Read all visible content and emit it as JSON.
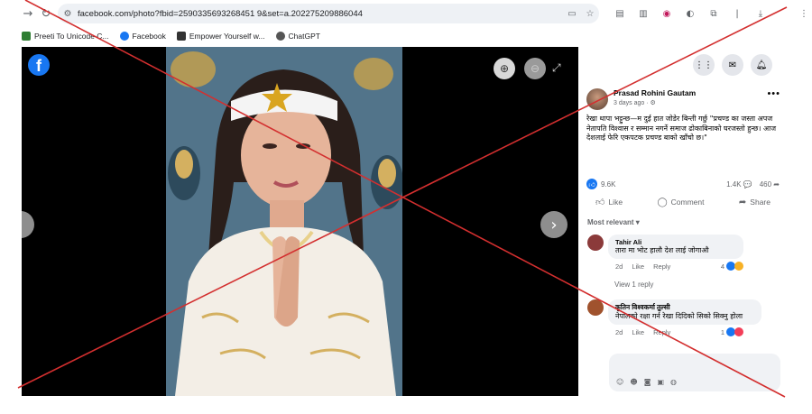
{
  "browser": {
    "url": "facebook.com/photo?fbid=2590335693268451 9&set=a.202275209886044",
    "bookmarks": [
      {
        "label": "Preeti To Unicode C...",
        "color": "#2e7d32"
      },
      {
        "label": "Facebook",
        "color": "#1877f2"
      },
      {
        "label": "Empower Yourself w...",
        "color": "#333333"
      },
      {
        "label": "ChatGPT",
        "color": "#555555"
      }
    ]
  },
  "viewer": {
    "logo_letter": "f",
    "zoom_in_icon": "zoom-in-icon",
    "zoom_out_icon": "zoom-out-icon",
    "expand_icon": "expand-icon",
    "next_icon": "chevron-right-icon"
  },
  "post": {
    "author": "Prasad Rohini Gautam",
    "meta": "3 days ago · ⚙",
    "text": "रेखा थापा भट्टुन्छ—म दुई हात जोडेर बिन्ती गर्छु \"प्रचण्ड का जस्ता अपज नेतापति विश्वास र सम्मान नगर्ने समाज ढोकाबिनाको घरजस्तो हुन्छ। आज देशलाई फेरि एकपटक प्रचण्ड बाको खाँचो छ।\"",
    "reactions_count": "9.6K",
    "comments_count": "1.4K 💬",
    "shares_count": "460 ➦",
    "actions": {
      "like": "Like",
      "comment": "Comment",
      "share": "Share"
    },
    "most_relevant": "Most relevant ▾"
  },
  "comments": [
    {
      "name": "Tahir Ali",
      "text": "तारा मा भोट हालौ देश लाई जोगाऔ",
      "time": "2d",
      "like": "Like",
      "reply": "Reply",
      "react_count": "4",
      "avatar_color": "#8b3a3a"
    },
    {
      "name": "कृतिन विश्वकर्मा तुल्सी",
      "text": "नेपालको रक्षा गर्न रेखा दिदिको सिको सिक्नु होला",
      "time": "2d",
      "like": "Like",
      "reply": "Reply",
      "react_count": "1",
      "avatar_color": "#a0522d"
    }
  ],
  "view_reply": "View 1 reply",
  "overlay": {
    "cross_color": "#d32f2f"
  }
}
